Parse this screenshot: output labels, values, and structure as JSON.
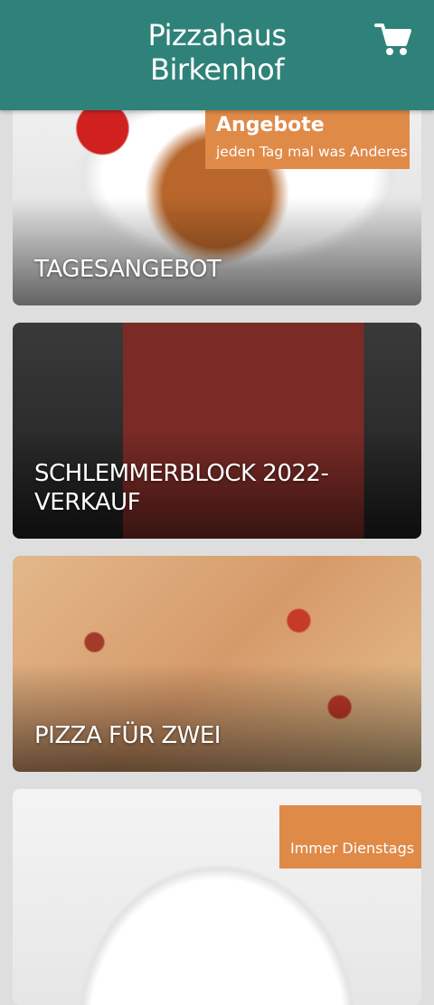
{
  "header": {
    "title_line1": "Pizzahaus",
    "title_line2": "Birkenhof",
    "cart_icon": "shopping-cart-icon"
  },
  "colors": {
    "header_bg": "#2f8279",
    "badge_bg": "#e08a48",
    "page_bg": "#dedede"
  },
  "cards": [
    {
      "label": "TAGESANGEBOT",
      "badge_title": "Angebote",
      "badge_subtitle": "jeden Tag mal was Anderes"
    },
    {
      "label": "SCHLEMMERBLOCK 2022-VERKAUF"
    },
    {
      "label": "PIZZA FÜR ZWEI"
    },
    {
      "label": "",
      "badge_subtitle": "Immer Dienstags"
    }
  ]
}
